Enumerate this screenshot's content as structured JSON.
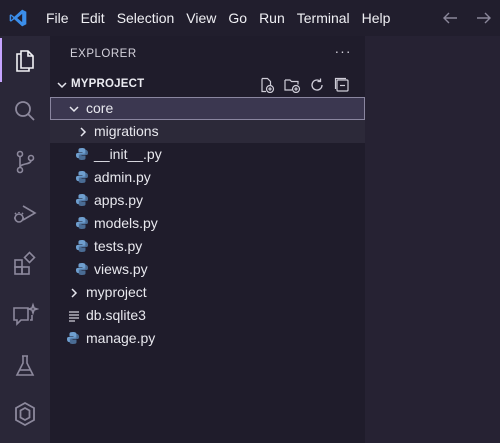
{
  "menu": {
    "items": [
      "File",
      "Edit",
      "Selection",
      "View",
      "Go",
      "Run",
      "Terminal",
      "Help"
    ]
  },
  "activity_bar": {
    "items": [
      {
        "name": "explorer-icon",
        "active": true
      },
      {
        "name": "search-icon",
        "active": false
      },
      {
        "name": "source-control-icon",
        "active": false
      },
      {
        "name": "run-debug-icon",
        "active": false
      },
      {
        "name": "extensions-icon",
        "active": false
      },
      {
        "name": "chat-icon",
        "active": false
      },
      {
        "name": "testing-icon",
        "active": false
      },
      {
        "name": "remote-icon",
        "active": false
      }
    ]
  },
  "sidebar": {
    "header": "EXPLORER",
    "more": "···",
    "section_title": "MYPROJECT",
    "section_actions": [
      "new-file-icon",
      "new-folder-icon",
      "refresh-icon",
      "collapse-all-icon"
    ]
  },
  "tree": [
    {
      "label": "core",
      "type": "folder",
      "expanded": true,
      "depth": 1,
      "selected": true
    },
    {
      "label": "migrations",
      "type": "folder",
      "expanded": false,
      "depth": 2,
      "hover": true
    },
    {
      "label": "__init__.py",
      "type": "python",
      "depth": 2
    },
    {
      "label": "admin.py",
      "type": "python",
      "depth": 2
    },
    {
      "label": "apps.py",
      "type": "python",
      "depth": 2
    },
    {
      "label": "models.py",
      "type": "python",
      "depth": 2
    },
    {
      "label": "tests.py",
      "type": "python",
      "depth": 2
    },
    {
      "label": "views.py",
      "type": "python",
      "depth": 2
    },
    {
      "label": "myproject",
      "type": "folder",
      "expanded": false,
      "depth": 1
    },
    {
      "label": "db.sqlite3",
      "type": "text",
      "depth": 1
    },
    {
      "label": "manage.py",
      "type": "python",
      "depth": 1
    }
  ],
  "colors": {
    "accent": "#c6a4ff",
    "vscode_logo": "#3b8eea",
    "python_icon": "#6f9fcf"
  }
}
